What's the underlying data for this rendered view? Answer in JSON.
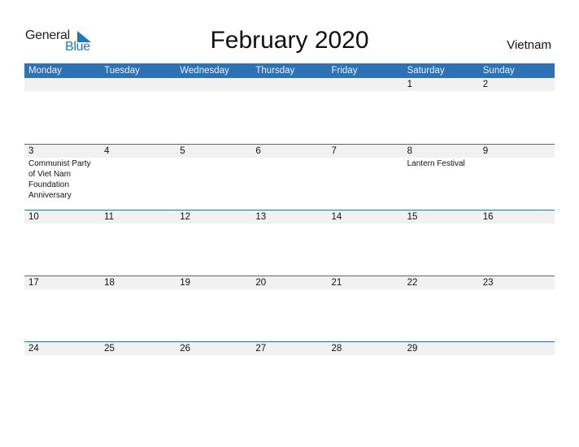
{
  "logo": {
    "general": "General",
    "blue": "Blue"
  },
  "title": "February 2020",
  "country": "Vietnam",
  "colors": {
    "accent": "#2e72b6",
    "logo_blue": "#1a7bc4",
    "day_number_bg": "#f1f1f1"
  },
  "weekdays": [
    "Monday",
    "Tuesday",
    "Wednesday",
    "Thursday",
    "Friday",
    "Saturday",
    "Sunday"
  ],
  "weeks": [
    [
      {
        "day": "",
        "event": ""
      },
      {
        "day": "",
        "event": ""
      },
      {
        "day": "",
        "event": ""
      },
      {
        "day": "",
        "event": ""
      },
      {
        "day": "",
        "event": ""
      },
      {
        "day": "1",
        "event": ""
      },
      {
        "day": "2",
        "event": ""
      }
    ],
    [
      {
        "day": "3",
        "event": "Communist Party of Viet Nam Foundation Anniversary"
      },
      {
        "day": "4",
        "event": ""
      },
      {
        "day": "5",
        "event": ""
      },
      {
        "day": "6",
        "event": ""
      },
      {
        "day": "7",
        "event": ""
      },
      {
        "day": "8",
        "event": "Lantern Festival"
      },
      {
        "day": "9",
        "event": ""
      }
    ],
    [
      {
        "day": "10",
        "event": ""
      },
      {
        "day": "11",
        "event": ""
      },
      {
        "day": "12",
        "event": ""
      },
      {
        "day": "13",
        "event": ""
      },
      {
        "day": "14",
        "event": ""
      },
      {
        "day": "15",
        "event": ""
      },
      {
        "day": "16",
        "event": ""
      }
    ],
    [
      {
        "day": "17",
        "event": ""
      },
      {
        "day": "18",
        "event": ""
      },
      {
        "day": "19",
        "event": ""
      },
      {
        "day": "20",
        "event": ""
      },
      {
        "day": "21",
        "event": ""
      },
      {
        "day": "22",
        "event": ""
      },
      {
        "day": "23",
        "event": ""
      }
    ],
    [
      {
        "day": "24",
        "event": ""
      },
      {
        "day": "25",
        "event": ""
      },
      {
        "day": "26",
        "event": ""
      },
      {
        "day": "27",
        "event": ""
      },
      {
        "day": "28",
        "event": ""
      },
      {
        "day": "29",
        "event": ""
      },
      {
        "day": "",
        "event": ""
      }
    ]
  ]
}
